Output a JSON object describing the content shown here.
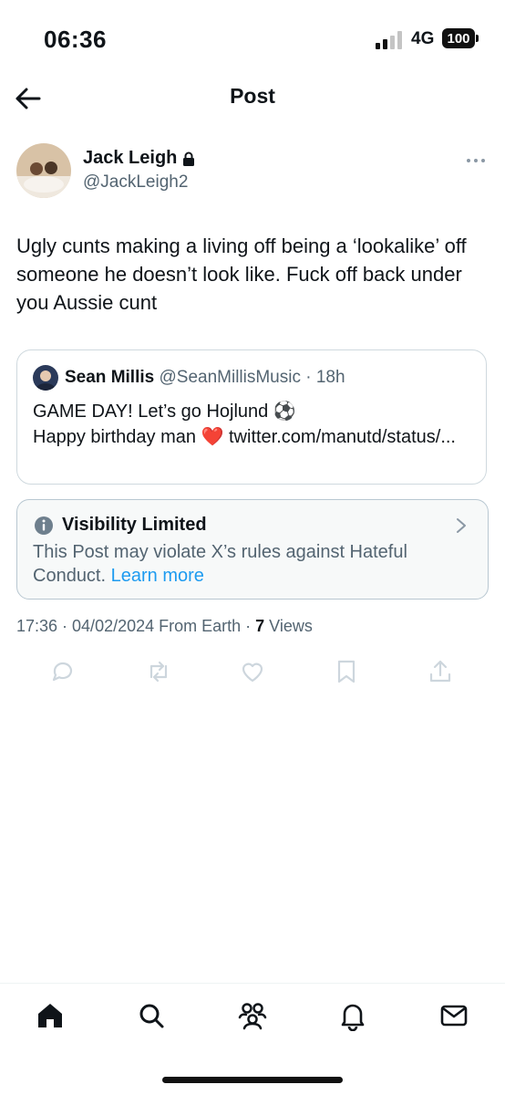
{
  "status_bar": {
    "time": "06:36",
    "network": "4G",
    "battery": "100"
  },
  "header": {
    "title": "Post"
  },
  "author": {
    "name": "Jack Leigh",
    "handle": "@JackLeigh2"
  },
  "tweet": {
    "text": "Ugly cunts making a living off being a ‘lookalike’ off someone he doesn’t look like. Fuck off back under you Aussie cunt"
  },
  "quoted": {
    "name": "Sean Millis",
    "handle_time": " @SeanMillisMusic · 18h",
    "line1": "GAME DAY! Let’s go Hojlund ⚽",
    "line2": "Happy birthday man ❤️ twitter.com/manutd/status/..."
  },
  "visibility": {
    "title": "Visibility Limited",
    "body": "This Post may violate X’s rules against Hateful Conduct.",
    "link": "Learn more"
  },
  "meta": {
    "timestamp": "17:36 · 04/02/2024 From Earth · ",
    "views_count": "7",
    "views_label": " Views"
  },
  "colors": {
    "accent": "#1d9bf0",
    "secondary_text": "#536471",
    "border": "#cfd9de"
  },
  "icons": {
    "actions": [
      "reply-icon",
      "repost-icon",
      "like-icon",
      "bookmark-icon",
      "share-icon"
    ],
    "nav": [
      "home-icon",
      "search-icon",
      "communities-icon",
      "notifications-icon",
      "messages-icon"
    ]
  }
}
